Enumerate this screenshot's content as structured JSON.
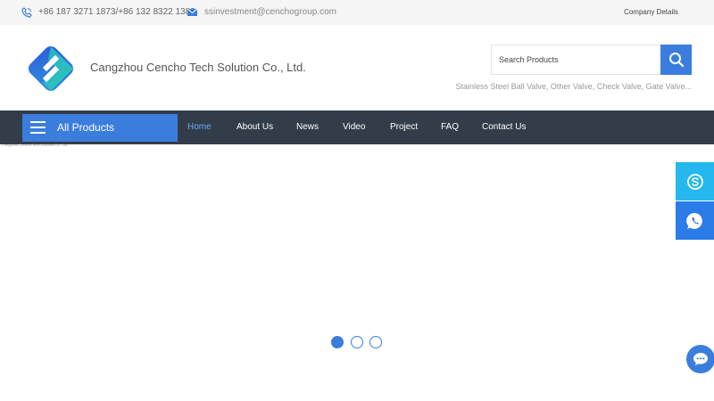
{
  "topbar": {
    "phone": "+86 187 3271 1873/+86 132 8322 1383",
    "email": "ssinvestment@cenchogroup.com",
    "company_details": "Company Details"
  },
  "header": {
    "company_name": "Cangzhou Cencho Tech Solution Co., Ltd.",
    "search_placeholder": "Search Products",
    "hot_keywords": "Stainless Steel Ball Valve, Other Valve, Check Valve, Gate Valve..."
  },
  "nav": {
    "all_products": "All Products",
    "items": [
      "Home",
      "About Us",
      "News",
      "Video",
      "Project",
      "FAQ",
      "Contact Us"
    ],
    "active_index": 0
  },
  "banner": {
    "caption": "Cangzhou Cencho Tech Solution Co., Ltd.",
    "slides": 3,
    "active_slide": 0
  },
  "colors": {
    "accent": "#3b7ddd",
    "nav_bg": "#333d4a",
    "skype": "#24b8ee",
    "whatsapp": "#2b7be8"
  },
  "icons": {
    "phone": "phone-icon",
    "mail": "mail-icon",
    "search": "search-icon",
    "menu": "menu-icon",
    "skype": "skype-icon",
    "whatsapp": "whatsapp-icon",
    "chat": "chat-icon"
  }
}
